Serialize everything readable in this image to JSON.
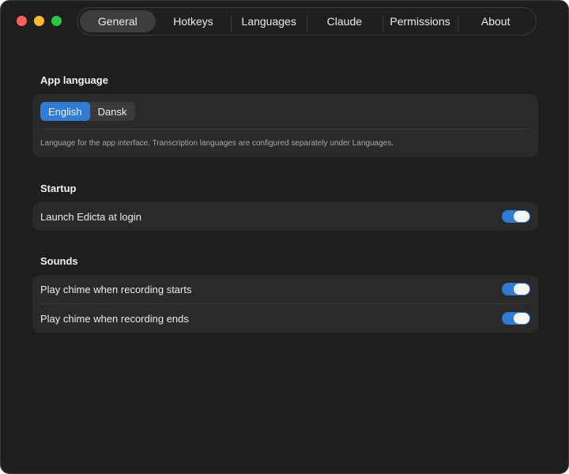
{
  "tabs": [
    {
      "label": "General",
      "active": true
    },
    {
      "label": "Hotkeys",
      "active": false
    },
    {
      "label": "Languages",
      "active": false
    },
    {
      "label": "Claude",
      "active": false
    },
    {
      "label": "Permissions",
      "active": false
    },
    {
      "label": "About",
      "active": false
    }
  ],
  "app_language": {
    "title": "App language",
    "options": [
      "English",
      "Dansk"
    ],
    "selected": "English",
    "helper": "Language for the app interface. Transcription languages are configured separately under Languages."
  },
  "startup": {
    "title": "Startup",
    "launch_label": "Launch Edicta at login",
    "launch_on": true
  },
  "sounds": {
    "title": "Sounds",
    "start_label": "Play chime when recording starts",
    "start_on": true,
    "end_label": "Play chime when recording ends",
    "end_on": true
  },
  "colors": {
    "accent": "#2f7cd6",
    "window_bg": "#1e1e1f",
    "card_bg": "#2a2a2b"
  }
}
